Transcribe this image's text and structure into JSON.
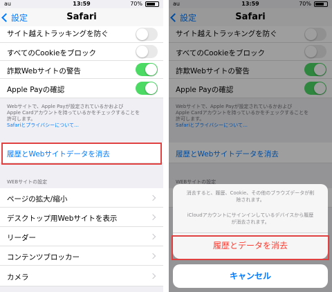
{
  "status": {
    "carrier": "au",
    "time": "13:59",
    "battery": "70%"
  },
  "nav": {
    "back": "設定",
    "title": "Safari"
  },
  "rows": {
    "cross_site": "サイト越えトラッキングを防ぐ",
    "block_cookies": "すべてのCookieをブロック",
    "fraud_warning": "詐欺Webサイトの警告",
    "apple_pay": "Apple Payの確認"
  },
  "toggles": {
    "cross_site": false,
    "block_cookies": false,
    "fraud_warning": true,
    "apple_pay": true
  },
  "footer": {
    "line1": "Webサイトで、Apple Payが設定されているかおよび",
    "line2": "Apple Cardアカウントを持っているかをチェックすることを",
    "line3": "許可します。",
    "link": "Safariとプライバシーについて…"
  },
  "clear_history": "履歴とWebサイトデータを消去",
  "section_header": "WEBサイトの設定",
  "settings": [
    "ページの拡大/縮小",
    "デスクトップ用Webサイトを表示",
    "リーダー",
    "コンテンツブロッカー",
    "カメラ"
  ],
  "sheet": {
    "msg1_line1": "消去すると、履歴、Cookie、その他のブラウズデータが削",
    "msg1_line2": "除されます。",
    "msg2_line1": "iCloudアカウントにサインインしているデバイスから履歴",
    "msg2_line2": "が消去されます。",
    "confirm": "履歴とデータを消去",
    "cancel": "キャンセル"
  },
  "colors": {
    "accent": "#007aff",
    "toggle_on": "#4cd964",
    "destructive": "#ff3b30",
    "highlight_box": "#e04040"
  }
}
